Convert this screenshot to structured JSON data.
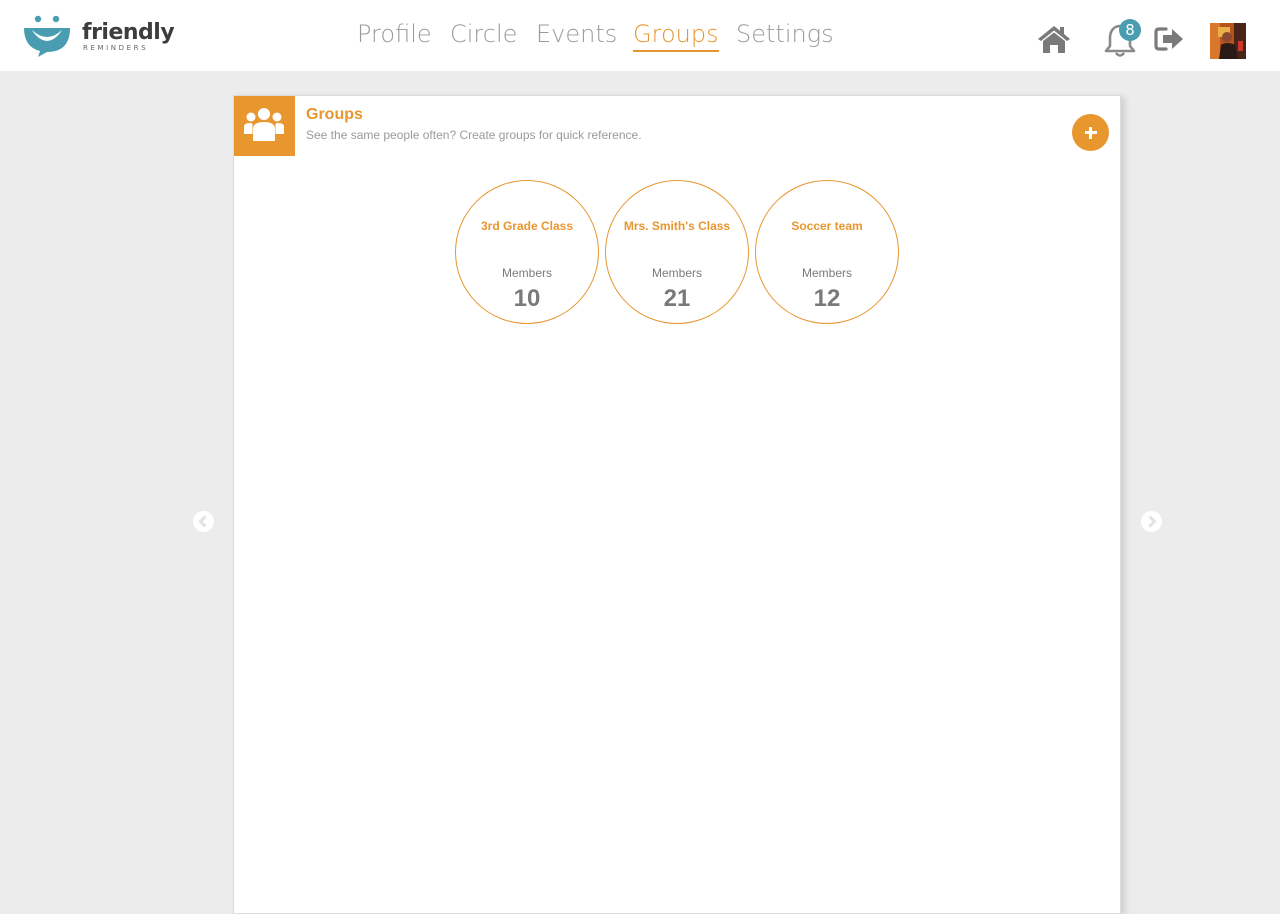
{
  "brand": {
    "name": "friendly",
    "tagline": "REMINDERS"
  },
  "nav": {
    "items": [
      {
        "label": "Profile",
        "active": false
      },
      {
        "label": "Circle",
        "active": false
      },
      {
        "label": "Events",
        "active": false
      },
      {
        "label": "Groups",
        "active": true
      },
      {
        "label": "Settings",
        "active": false
      }
    ]
  },
  "header_actions": {
    "home_icon": "home-icon",
    "notifications_icon": "bell-icon",
    "notifications_count": "8",
    "logout_icon": "sign-out-icon",
    "avatar_icon": "user-avatar"
  },
  "panel": {
    "icon": "users-icon",
    "title": "Groups",
    "subtitle": "See the same people often? Create groups for quick reference.",
    "add_icon": "plus-icon"
  },
  "groups": [
    {
      "name": "3rd Grade Class",
      "members_label": "Members",
      "members_count": "10"
    },
    {
      "name": "Mrs. Smith's Class",
      "members_label": "Members",
      "members_count": "21"
    },
    {
      "name": "Soccer team",
      "members_label": "Members",
      "members_count": "12"
    }
  ],
  "pager": {
    "prev_icon": "chevron-left-icon",
    "next_icon": "chevron-right-icon"
  },
  "colors": {
    "accent": "#e8962e",
    "teal": "#4a9db1",
    "nav_inactive": "#9a9a9a",
    "background": "#ececec"
  }
}
